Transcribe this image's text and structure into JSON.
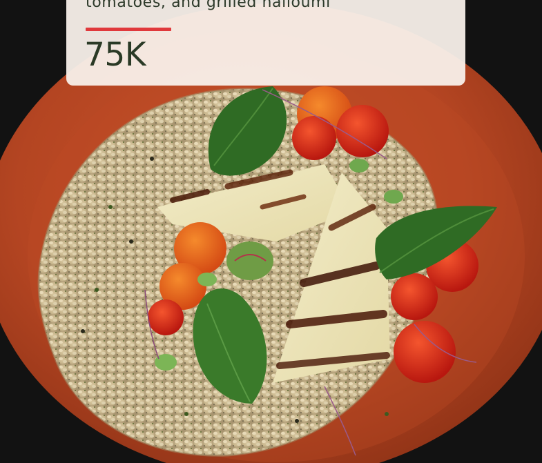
{
  "card": {
    "title": "tomatoes, and grilled halloumi",
    "stat": "75K",
    "accent_color": "#e0393c"
  },
  "photo": {
    "subject": "bowl-of-bulgur-with-grilled-halloumi-tomatoes-and-basil-icon"
  }
}
